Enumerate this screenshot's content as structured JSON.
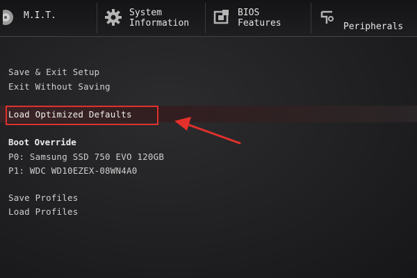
{
  "tabs": [
    {
      "id": "mit",
      "label_lines": [
        "M.I.T."
      ],
      "icon": "gauge-icon"
    },
    {
      "id": "sys",
      "label_lines": [
        "System",
        "Information"
      ],
      "icon": "gear-icon"
    },
    {
      "id": "bios",
      "label_lines": [
        "BIOS",
        "Features"
      ],
      "icon": "bios-chip-icon"
    },
    {
      "id": "per",
      "label_lines": [
        "Peripherals"
      ],
      "icon": "peripherals-icon"
    }
  ],
  "menu": {
    "save_exit": "Save & Exit Setup",
    "exit_no_save": "Exit Without Saving",
    "load_defaults": "Load Optimized Defaults",
    "boot_override_title": "Boot Override",
    "boot_p0": "P0: Samsung SSD 750 EVO 120GB",
    "boot_p1": "P1: WDC WD10EZEX-08WN4A0",
    "save_profiles": "Save Profiles",
    "load_profiles": "Load Profiles"
  },
  "annotation": {
    "color": "#e4302c"
  }
}
